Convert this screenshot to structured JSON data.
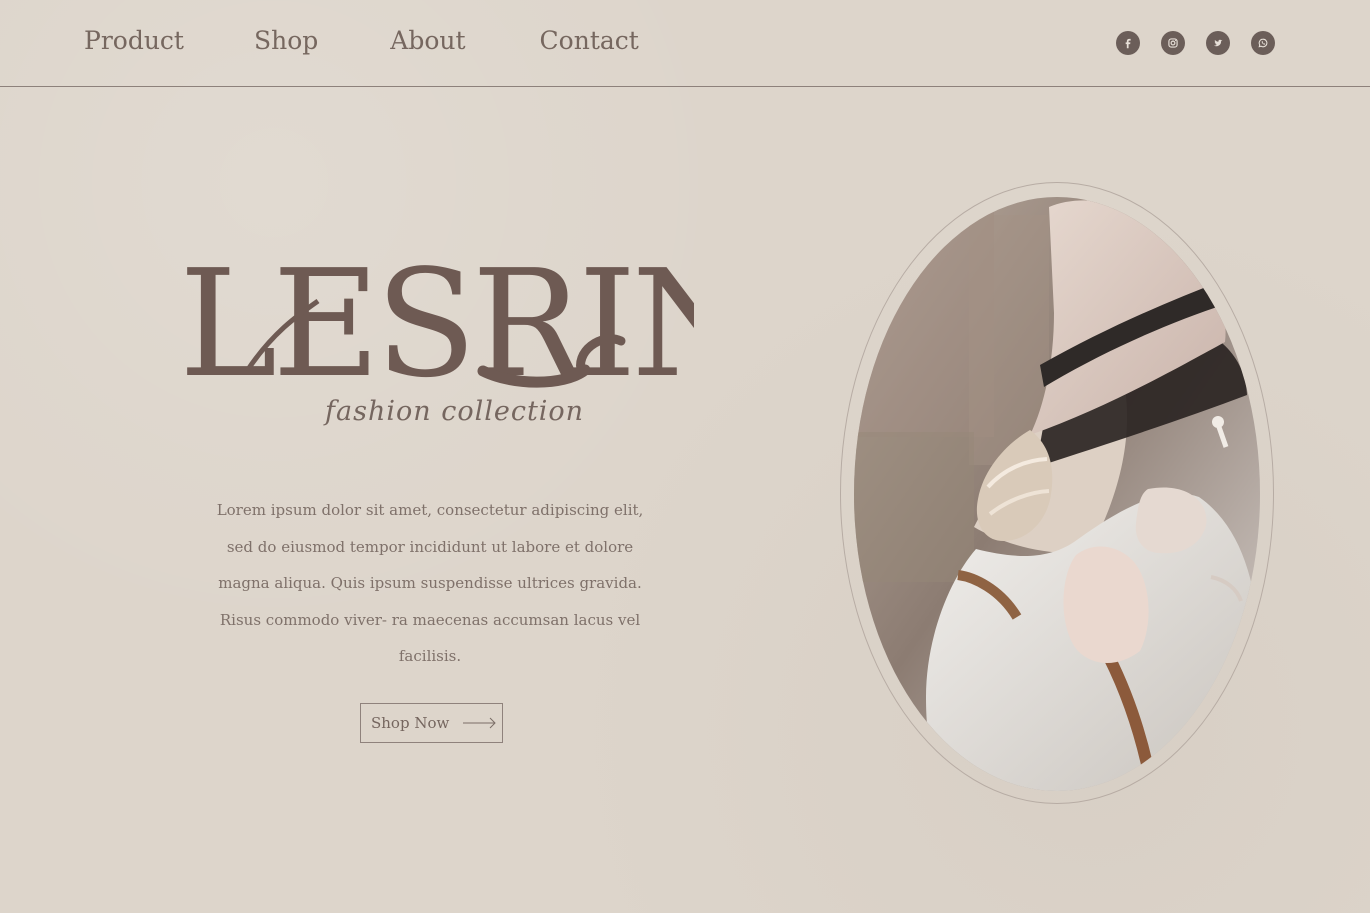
{
  "nav": {
    "links": [
      {
        "label": "Product"
      },
      {
        "label": "Shop"
      },
      {
        "label": "About"
      },
      {
        "label": "Contact"
      }
    ]
  },
  "social": {
    "icons": [
      "facebook-icon",
      "instagram-icon",
      "twitter-icon",
      "whatsapp-icon"
    ]
  },
  "hero": {
    "brand": "LESRIN",
    "tagline": "fashion collection",
    "description": "Lorem ipsum dolor sit amet, consectetur adipiscing elit, sed do eiusmod tempor incididunt ut labore et dolore magna aliqua. Quis ipsum suspendisse ultrices gravida. Risus commodo viver- ra maecenas accumsan lacus vel facilisis.",
    "cta_label": "Shop Now"
  },
  "colors": {
    "background": "#ddd5cb",
    "text": "#6f625c",
    "brand": "#6e5a53",
    "line": "#8d817b"
  }
}
